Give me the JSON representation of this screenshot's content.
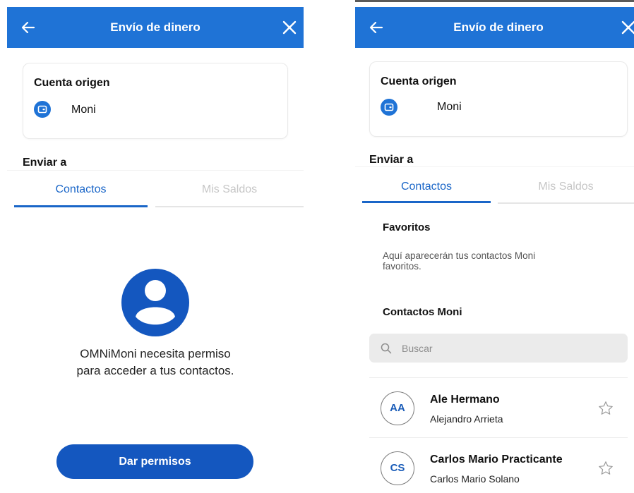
{
  "colors": {
    "primary": "#1f73d6",
    "button": "#1457bf",
    "tab_active": "#1a66c8"
  },
  "left": {
    "header": {
      "title": "Envío de dinero",
      "back_icon": "arrow-left-icon",
      "close_icon": "close-icon"
    },
    "origin": {
      "title": "Cuenta origen",
      "account_name": "Moni",
      "account_icon": "wallet-icon"
    },
    "send_to_label": "Enviar a",
    "tabs": [
      {
        "label": "Contactos",
        "active": true
      },
      {
        "label": "Mis Saldos",
        "active": false
      }
    ],
    "permission": {
      "icon": "user-silhouette-icon",
      "line1": "OMNiMoni necesita permiso",
      "line2": "para acceder a tus contactos.",
      "button_label": "Dar permisos"
    }
  },
  "right": {
    "header": {
      "title": "Envío de dinero",
      "back_icon": "arrow-left-icon",
      "close_icon": "close-icon"
    },
    "origin": {
      "title": "Cuenta origen",
      "account_name": "Moni",
      "account_icon": "wallet-icon"
    },
    "send_to_label": "Enviar a",
    "tabs": [
      {
        "label": "Contactos",
        "active": true
      },
      {
        "label": "Mis Saldos",
        "active": false
      }
    ],
    "favorites": {
      "heading": "Favoritos",
      "empty_text": "Aquí aparecerán tus contactos Moni favoritos."
    },
    "contacts_heading": "Contactos Moni",
    "search": {
      "placeholder": "Buscar",
      "value": "",
      "icon": "search-icon"
    },
    "contacts": [
      {
        "initials": "AA",
        "name": "Ale Hermano",
        "full_name": "Alejandro Arrieta",
        "favorite": false
      },
      {
        "initials": "CS",
        "name": "Carlos Mario Practicante",
        "full_name": "Carlos Mario Solano",
        "favorite": false
      }
    ]
  }
}
